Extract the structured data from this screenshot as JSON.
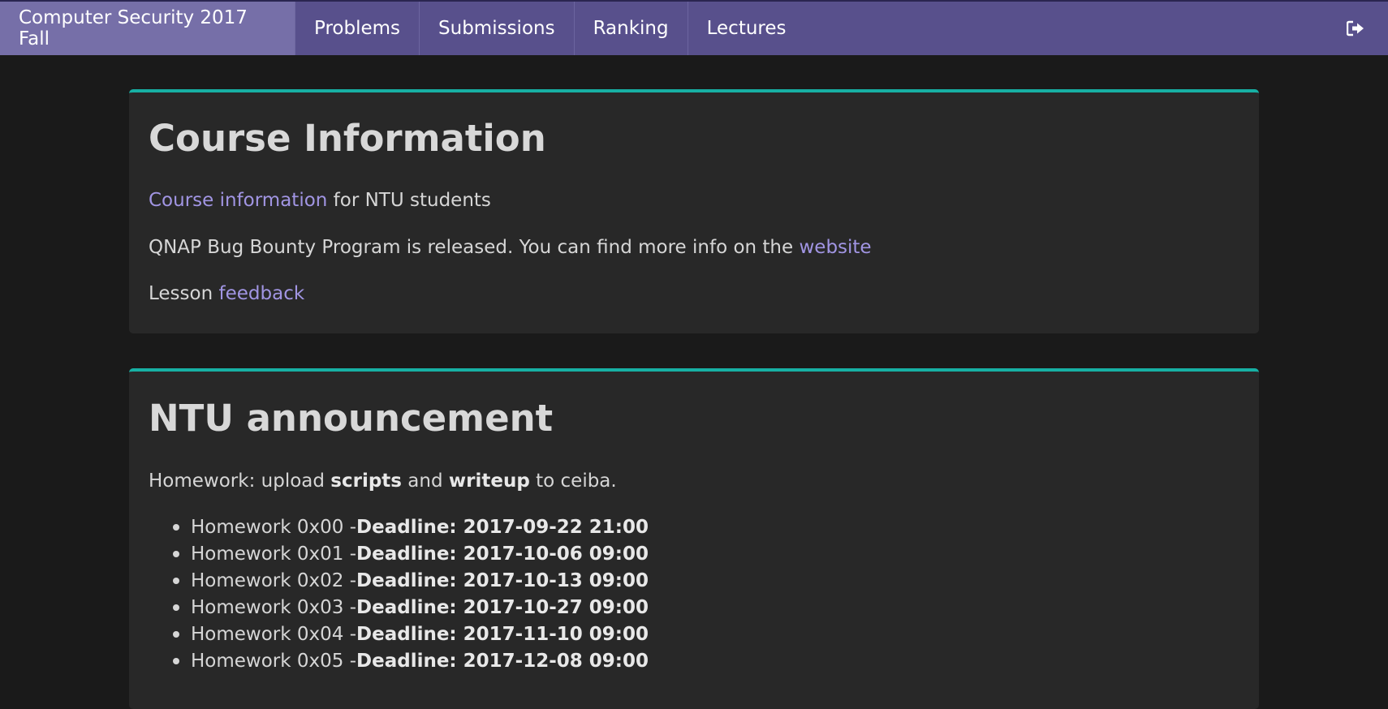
{
  "navbar": {
    "brand": "Computer Security 2017 Fall",
    "items": [
      "Problems",
      "Submissions",
      "Ranking",
      "Lectures"
    ],
    "logout_icon": "sign-out-icon"
  },
  "course_info": {
    "title": "Course Information",
    "line1_link": "Course information",
    "line1_text": " for NTU students",
    "line2_text": "QNAP Bug Bounty Program is released. You can find more info on the ",
    "line2_link": "website",
    "line3_text": "Lesson ",
    "line3_link": "feedback"
  },
  "announcement": {
    "title": "NTU announcement",
    "intro_pre": "Homework: upload ",
    "intro_b1": "scripts",
    "intro_mid": " and ",
    "intro_b2": "writeup",
    "intro_post": " to ceiba.",
    "homeworks": [
      {
        "name": "Homework 0x00 - ",
        "deadline": "Deadline: 2017-09-22 21:00"
      },
      {
        "name": "Homework 0x01 - ",
        "deadline": "Deadline: 2017-10-06 09:00"
      },
      {
        "name": "Homework 0x02 - ",
        "deadline": "Deadline: 2017-10-13 09:00"
      },
      {
        "name": "Homework 0x03 - ",
        "deadline": "Deadline: 2017-10-27 09:00"
      },
      {
        "name": "Homework 0x04 - ",
        "deadline": "Deadline: 2017-11-10 09:00"
      },
      {
        "name": "Homework 0x05 - ",
        "deadline": "Deadline: 2017-12-08 09:00"
      }
    ]
  },
  "colors": {
    "navbar": "#58508c",
    "brand_bg": "#766fa8",
    "accent": "#17b0a4",
    "link": "#a195e3",
    "panel_bg": "#282828",
    "page_bg": "#1a1a1a"
  }
}
